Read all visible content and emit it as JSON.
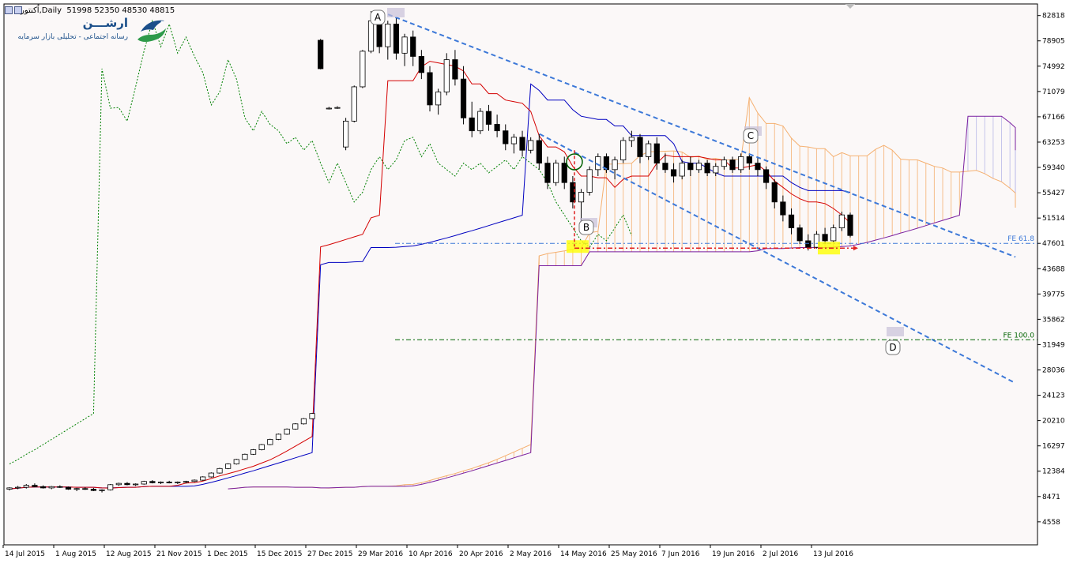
{
  "header": {
    "symbol_text": "اُکنتور,Daily",
    "ohlc_text": "51998 52350 48530 48815"
  },
  "logo": {
    "title": "ارشـــن",
    "subtitle": "رسانه اجتماعی - تحلیلی بازار سرمایه"
  },
  "colors": {
    "background": "#fbf8f8",
    "bull_candle": "#ffffff",
    "bear_candle": "#000000",
    "tenkan": "#d40000",
    "kijun": "#0000c0",
    "chikou": "#008000",
    "senkou_b": "#7a1fa0",
    "kumo_fill": "#f5b070",
    "kumo_fill_bear": "#b8b8e8",
    "channel": "#3c78d8",
    "fibo_618": "#3c78d8",
    "fibo_100": "#006400",
    "highlight_yellow": "#ffff00",
    "arrow_red": "#e02020"
  },
  "chart_data": {
    "type": "candlestick",
    "title": "",
    "indicator": "Ichimoku Kinko Hyo",
    "ylim": [
      1000,
      84000
    ],
    "y_ticks": [
      "82818",
      "78905",
      "74992",
      "71079",
      "67166",
      "63253",
      "59340",
      "55427",
      "51514",
      "47601",
      "43688",
      "39775",
      "35862",
      "31949",
      "28036",
      "24123",
      "20210",
      "16297",
      "12384",
      "8471",
      "4558"
    ],
    "x_ticks": [
      "14 Jul 2015",
      "1 Aug 2015",
      "12 Aug 2015",
      "21 Nov 2015",
      "1 Dec 2015",
      "15 Dec 2015",
      "27 Dec 2015",
      "29 Mar 2016",
      "10 Apr 2016",
      "20 Apr 2016",
      "2 May 2016",
      "14 May 2016",
      "25 May 2016",
      "7 Jun 2016",
      "19 Jun 2016",
      "2 Jul 2016",
      "13 Jul 2016"
    ],
    "candles": [
      [
        9600,
        9900,
        9400,
        9800
      ],
      [
        9800,
        10100,
        9600,
        9900
      ],
      [
        9900,
        10400,
        9700,
        10200
      ],
      [
        10200,
        10500,
        9900,
        10000
      ],
      [
        10000,
        10200,
        9700,
        9800
      ],
      [
        9800,
        10100,
        9600,
        10000
      ],
      [
        10000,
        10200,
        9800,
        9900
      ],
      [
        9900,
        10000,
        9500,
        9600
      ],
      [
        9600,
        9800,
        9300,
        9700
      ],
      [
        9700,
        9900,
        9500,
        9600
      ],
      [
        9600,
        9800,
        9300,
        9400
      ],
      [
        9400,
        9600,
        9100,
        9500
      ],
      [
        9500,
        10400,
        9400,
        10300
      ],
      [
        10300,
        10600,
        10100,
        10500
      ],
      [
        10500,
        10700,
        10200,
        10300
      ],
      [
        10300,
        10500,
        10100,
        10400
      ],
      [
        10400,
        10900,
        10300,
        10800
      ],
      [
        10800,
        11000,
        10500,
        10600
      ],
      [
        10600,
        10800,
        10400,
        10700
      ],
      [
        10700,
        10900,
        10500,
        10600
      ],
      [
        10600,
        10800,
        10400,
        10700
      ],
      [
        10700,
        10900,
        10500,
        10800
      ],
      [
        10800,
        11100,
        10700,
        11000
      ],
      [
        11000,
        11600,
        10900,
        11500
      ],
      [
        11500,
        12200,
        11400,
        12100
      ],
      [
        12100,
        12900,
        12000,
        12800
      ],
      [
        12800,
        13600,
        12700,
        13500
      ],
      [
        13500,
        14300,
        13400,
        14200
      ],
      [
        14200,
        15100,
        14100,
        15000
      ],
      [
        15000,
        15800,
        14900,
        15700
      ],
      [
        15700,
        16600,
        15600,
        16500
      ],
      [
        16500,
        17400,
        16400,
        17300
      ],
      [
        17300,
        18200,
        17200,
        18100
      ],
      [
        18100,
        19000,
        18000,
        18900
      ],
      [
        18900,
        19800,
        18800,
        19700
      ],
      [
        19700,
        20600,
        19600,
        20500
      ],
      [
        20500,
        21400,
        20400,
        21300
      ],
      [
        79000,
        79200,
        74500,
        74600
      ],
      [
        68500,
        68700,
        68300,
        68500
      ],
      [
        68600,
        68800,
        68400,
        68600
      ],
      [
        62500,
        67000,
        62000,
        66500
      ],
      [
        66500,
        72000,
        66300,
        71800
      ],
      [
        71800,
        77500,
        71600,
        77300
      ],
      [
        77300,
        83500,
        77000,
        82000
      ],
      [
        82000,
        83000,
        77000,
        78000
      ],
      [
        78000,
        82000,
        76000,
        81500
      ],
      [
        81500,
        82500,
        76000,
        77000
      ],
      [
        77000,
        80000,
        75000,
        79500
      ],
      [
        79500,
        80500,
        75000,
        76500
      ],
      [
        76500,
        77500,
        73000,
        74000
      ],
      [
        74000,
        75000,
        68000,
        69000
      ],
      [
        69000,
        71500,
        67500,
        71000
      ],
      [
        71000,
        77000,
        70500,
        76000
      ],
      [
        76000,
        77500,
        72000,
        73000
      ],
      [
        73000,
        75000,
        66000,
        67000
      ],
      [
        67000,
        69500,
        64000,
        65000
      ],
      [
        65000,
        68500,
        64500,
        68000
      ],
      [
        68000,
        69000,
        65000,
        66000
      ],
      [
        66000,
        67500,
        64000,
        65000
      ],
      [
        65000,
        66000,
        62000,
        63000
      ],
      [
        63000,
        64500,
        61500,
        64000
      ],
      [
        64000,
        65000,
        61000,
        62000
      ],
      [
        62000,
        64000,
        61500,
        63500
      ],
      [
        63500,
        64500,
        59000,
        60000
      ],
      [
        60000,
        61000,
        56000,
        57000
      ],
      [
        57000,
        60500,
        56500,
        60000
      ],
      [
        60000,
        61000,
        56000,
        57000
      ],
      [
        57000,
        58000,
        53000,
        54000
      ],
      [
        54000,
        56000,
        51000,
        55500
      ],
      [
        55500,
        59500,
        55000,
        59000
      ],
      [
        59000,
        61500,
        58000,
        61000
      ],
      [
        61000,
        61500,
        58500,
        59000
      ],
      [
        59000,
        61000,
        57500,
        60500
      ],
      [
        60500,
        64000,
        60000,
        63500
      ],
      [
        63500,
        65000,
        62500,
        64000
      ],
      [
        64000,
        64500,
        60000,
        61000
      ],
      [
        61000,
        63500,
        60500,
        63000
      ],
      [
        63000,
        64000,
        59000,
        60000
      ],
      [
        60000,
        61500,
        58500,
        59000
      ],
      [
        59000,
        60000,
        57000,
        58000
      ],
      [
        58000,
        60500,
        57500,
        60000
      ],
      [
        60000,
        61000,
        58000,
        59000
      ],
      [
        59000,
        60500,
        58500,
        60000
      ],
      [
        60000,
        60500,
        58000,
        58500
      ],
      [
        58500,
        60000,
        58000,
        59500
      ],
      [
        59500,
        61000,
        59000,
        60500
      ],
      [
        60500,
        61000,
        58500,
        59000
      ],
      [
        59000,
        61500,
        58500,
        61000
      ],
      [
        61000,
        61500,
        59000,
        60000
      ],
      [
        60000,
        61000,
        58000,
        59000
      ],
      [
        59000,
        59500,
        56000,
        57000
      ],
      [
        57000,
        57500,
        53000,
        54000
      ],
      [
        54000,
        55000,
        51000,
        52000
      ],
      [
        52000,
        53000,
        49000,
        50000
      ],
      [
        50000,
        50500,
        47500,
        48000
      ],
      [
        48000,
        49000,
        46500,
        47000
      ],
      [
        47000,
        49500,
        46800,
        49000
      ],
      [
        49000,
        50000,
        47500,
        48000
      ],
      [
        48000,
        50500,
        47800,
        50000
      ],
      [
        50000,
        52500,
        49500,
        52000
      ],
      [
        51998,
        52350,
        48530,
        48815
      ]
    ],
    "lines": {
      "tenkan": "Tenkan-sen",
      "kijun": "Kijun-sen",
      "chikou": "Chikou Span",
      "senkou_a": "Senkou Span A",
      "senkou_b": "Senkou Span B"
    },
    "channel": {
      "upper": {
        "from": [
          "29 Mar 2016",
          83000
        ],
        "to": [
          "end",
          45500
        ]
      },
      "lower": {
        "from": [
          "2 May 2016",
          64500
        ],
        "to": [
          "end",
          26000
        ]
      }
    },
    "fibonacci": [
      {
        "label": "FE 61.8",
        "value": 47601
      },
      {
        "label": "FE 100.0",
        "value": 32700
      }
    ],
    "annotations": [
      {
        "label": "A",
        "date": "29 Mar 2016",
        "value": 83000
      },
      {
        "label": "B",
        "date": "14 May 2016",
        "value": 50200
      },
      {
        "label": "C",
        "date": "19 Jun 2016",
        "value": 63500
      },
      {
        "label": "D",
        "date": "end",
        "value": 31300
      }
    ]
  }
}
